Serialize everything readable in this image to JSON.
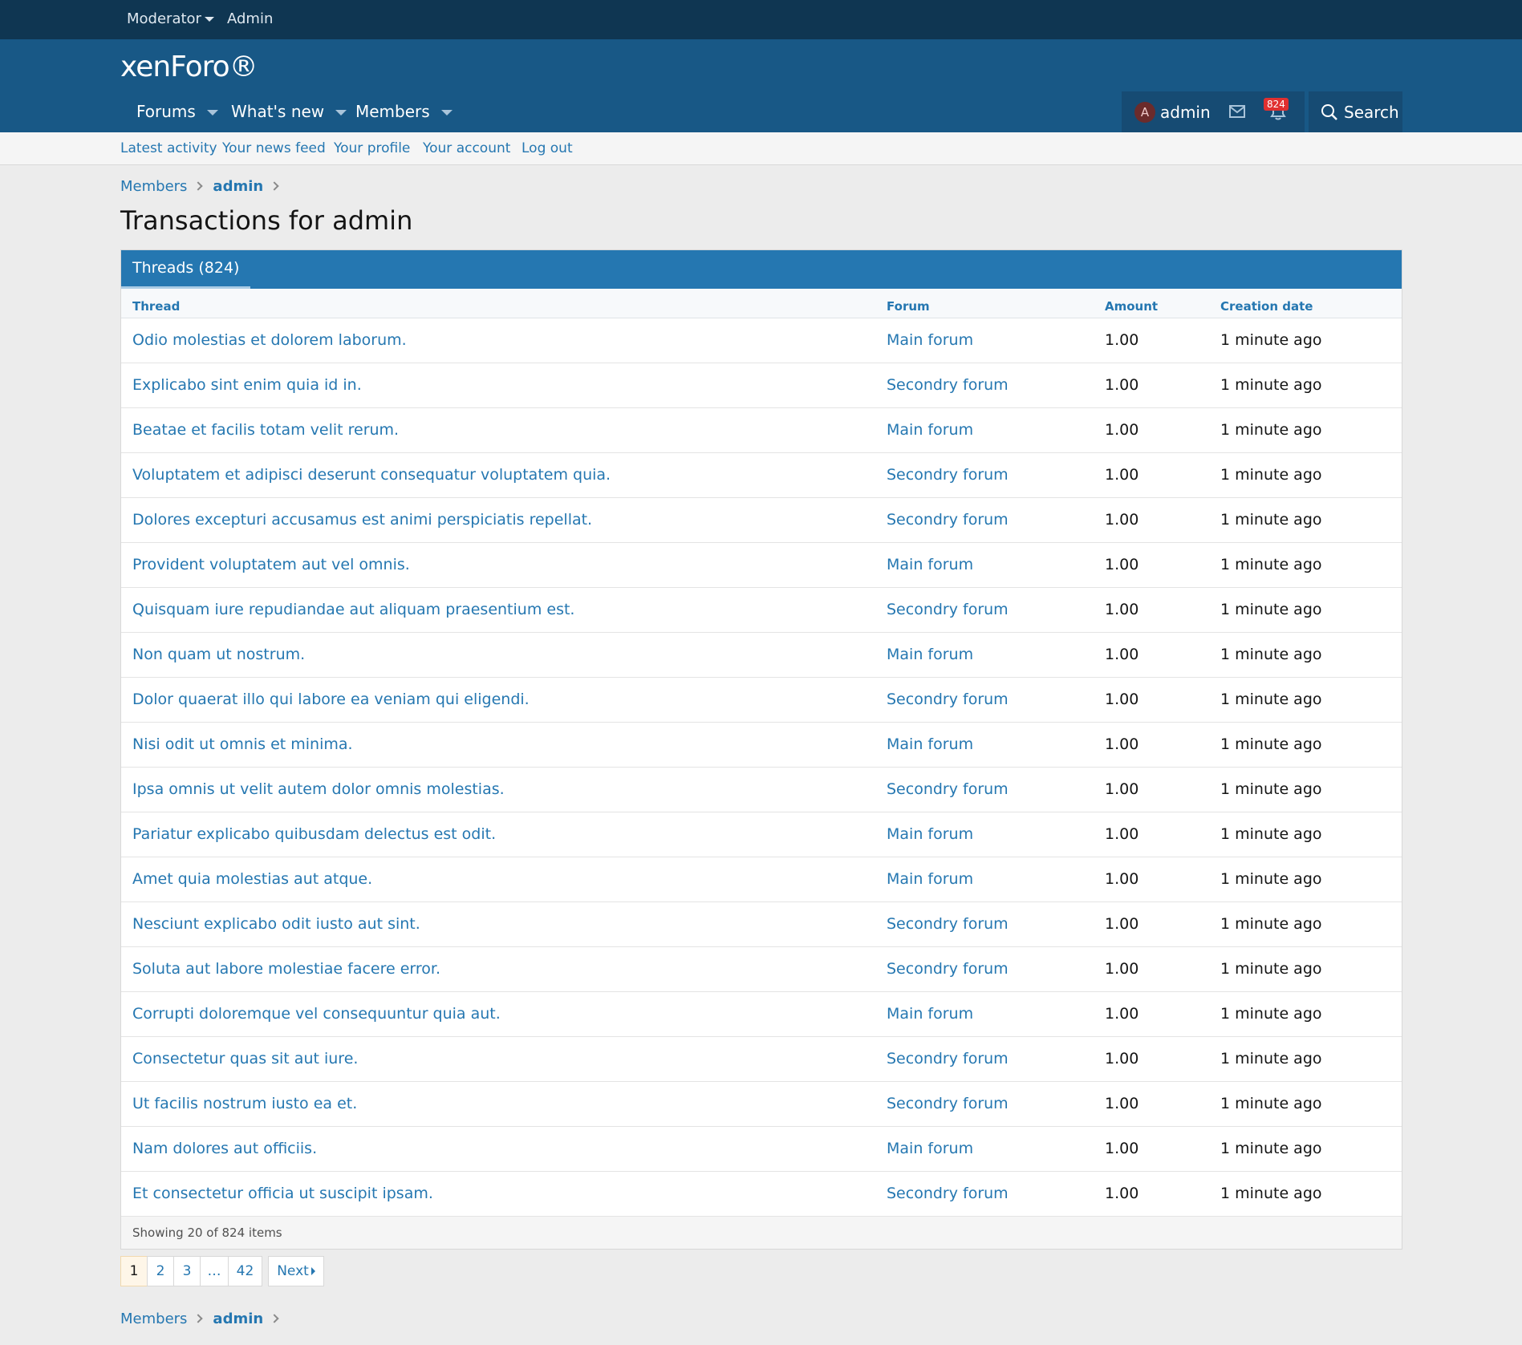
{
  "staff_bar": {
    "moderator": "Moderator",
    "admin": "Admin"
  },
  "header": {
    "logo": "xenForo",
    "nav": {
      "forums": "Forums",
      "whats_new": "What's new",
      "members": "Members"
    },
    "user": {
      "avatar_letter": "A",
      "name": "admin",
      "alert_count": "824"
    },
    "search_label": "Search"
  },
  "subnav": {
    "latest_activity": "Latest activity",
    "news_feed": "Your news feed",
    "profile": "Your profile",
    "account": "Your account",
    "logout": "Log out"
  },
  "breadcrumb": {
    "members": "Members",
    "user": "admin"
  },
  "page_title": "Transactions for admin",
  "tab_label": "Threads (824)",
  "table": {
    "headers": {
      "thread": "Thread",
      "forum": "Forum",
      "amount": "Amount",
      "date": "Creation date"
    },
    "rows": [
      {
        "thread": "Odio molestias et dolorem laborum.",
        "forum": "Main forum",
        "amount": "1.00",
        "date": "1 minute ago"
      },
      {
        "thread": "Explicabo sint enim quia id in.",
        "forum": "Secondry forum",
        "amount": "1.00",
        "date": "1 minute ago"
      },
      {
        "thread": "Beatae et facilis totam velit rerum.",
        "forum": "Main forum",
        "amount": "1.00",
        "date": "1 minute ago"
      },
      {
        "thread": "Voluptatem et adipisci deserunt consequatur voluptatem quia.",
        "forum": "Secondry forum",
        "amount": "1.00",
        "date": "1 minute ago"
      },
      {
        "thread": "Dolores excepturi accusamus est animi perspiciatis repellat.",
        "forum": "Secondry forum",
        "amount": "1.00",
        "date": "1 minute ago"
      },
      {
        "thread": "Provident voluptatem aut vel omnis.",
        "forum": "Main forum",
        "amount": "1.00",
        "date": "1 minute ago"
      },
      {
        "thread": "Quisquam iure repudiandae aut aliquam praesentium est.",
        "forum": "Secondry forum",
        "amount": "1.00",
        "date": "1 minute ago"
      },
      {
        "thread": "Non quam ut nostrum.",
        "forum": "Main forum",
        "amount": "1.00",
        "date": "1 minute ago"
      },
      {
        "thread": "Dolor quaerat illo qui labore ea veniam qui eligendi.",
        "forum": "Secondry forum",
        "amount": "1.00",
        "date": "1 minute ago"
      },
      {
        "thread": "Nisi odit ut omnis et minima.",
        "forum": "Main forum",
        "amount": "1.00",
        "date": "1 minute ago"
      },
      {
        "thread": "Ipsa omnis ut velit autem dolor omnis molestias.",
        "forum": "Secondry forum",
        "amount": "1.00",
        "date": "1 minute ago"
      },
      {
        "thread": "Pariatur explicabo quibusdam delectus est odit.",
        "forum": "Main forum",
        "amount": "1.00",
        "date": "1 minute ago"
      },
      {
        "thread": "Amet quia molestias aut atque.",
        "forum": "Main forum",
        "amount": "1.00",
        "date": "1 minute ago"
      },
      {
        "thread": "Nesciunt explicabo odit iusto aut sint.",
        "forum": "Secondry forum",
        "amount": "1.00",
        "date": "1 minute ago"
      },
      {
        "thread": "Soluta aut labore molestiae facere error.",
        "forum": "Secondry forum",
        "amount": "1.00",
        "date": "1 minute ago"
      },
      {
        "thread": "Corrupti doloremque vel consequuntur quia aut.",
        "forum": "Main forum",
        "amount": "1.00",
        "date": "1 minute ago"
      },
      {
        "thread": "Consectetur quas sit aut iure.",
        "forum": "Secondry forum",
        "amount": "1.00",
        "date": "1 minute ago"
      },
      {
        "thread": "Ut facilis nostrum iusto ea et.",
        "forum": "Secondry forum",
        "amount": "1.00",
        "date": "1 minute ago"
      },
      {
        "thread": "Nam dolores aut officiis.",
        "forum": "Main forum",
        "amount": "1.00",
        "date": "1 minute ago"
      },
      {
        "thread": "Et consectetur officia ut suscipit ipsam.",
        "forum": "Secondry forum",
        "amount": "1.00",
        "date": "1 minute ago"
      }
    ],
    "footer": "Showing 20 of 824 items"
  },
  "pagination": {
    "p1": "1",
    "p2": "2",
    "p3": "3",
    "ellipsis": "…",
    "last": "42",
    "next": "Next"
  },
  "colors": {
    "header": "#185886",
    "staff_bar": "#0f3652",
    "accent": "#2577b1",
    "badge": "#e03030"
  }
}
